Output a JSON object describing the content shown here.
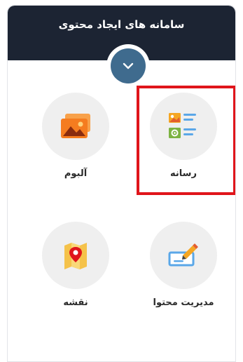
{
  "header": {
    "title": "سامانه های ایجاد محتوی"
  },
  "tiles": [
    {
      "label": "رسانه",
      "icon": "media-icon"
    },
    {
      "label": "آلبوم",
      "icon": "album-icon"
    },
    {
      "label": "مدیریت محتوا",
      "icon": "content-edit-icon"
    },
    {
      "label": "نقشه",
      "icon": "map-icon"
    }
  ],
  "colors": {
    "header_bg": "#1c2433",
    "toggle_bg": "#3f6b8e",
    "tile_circle": "#efefef",
    "highlight": "#e0151b",
    "album_orange": "#f57c1f",
    "media_blue": "#5aa7e8",
    "media_green": "#7cb342"
  }
}
